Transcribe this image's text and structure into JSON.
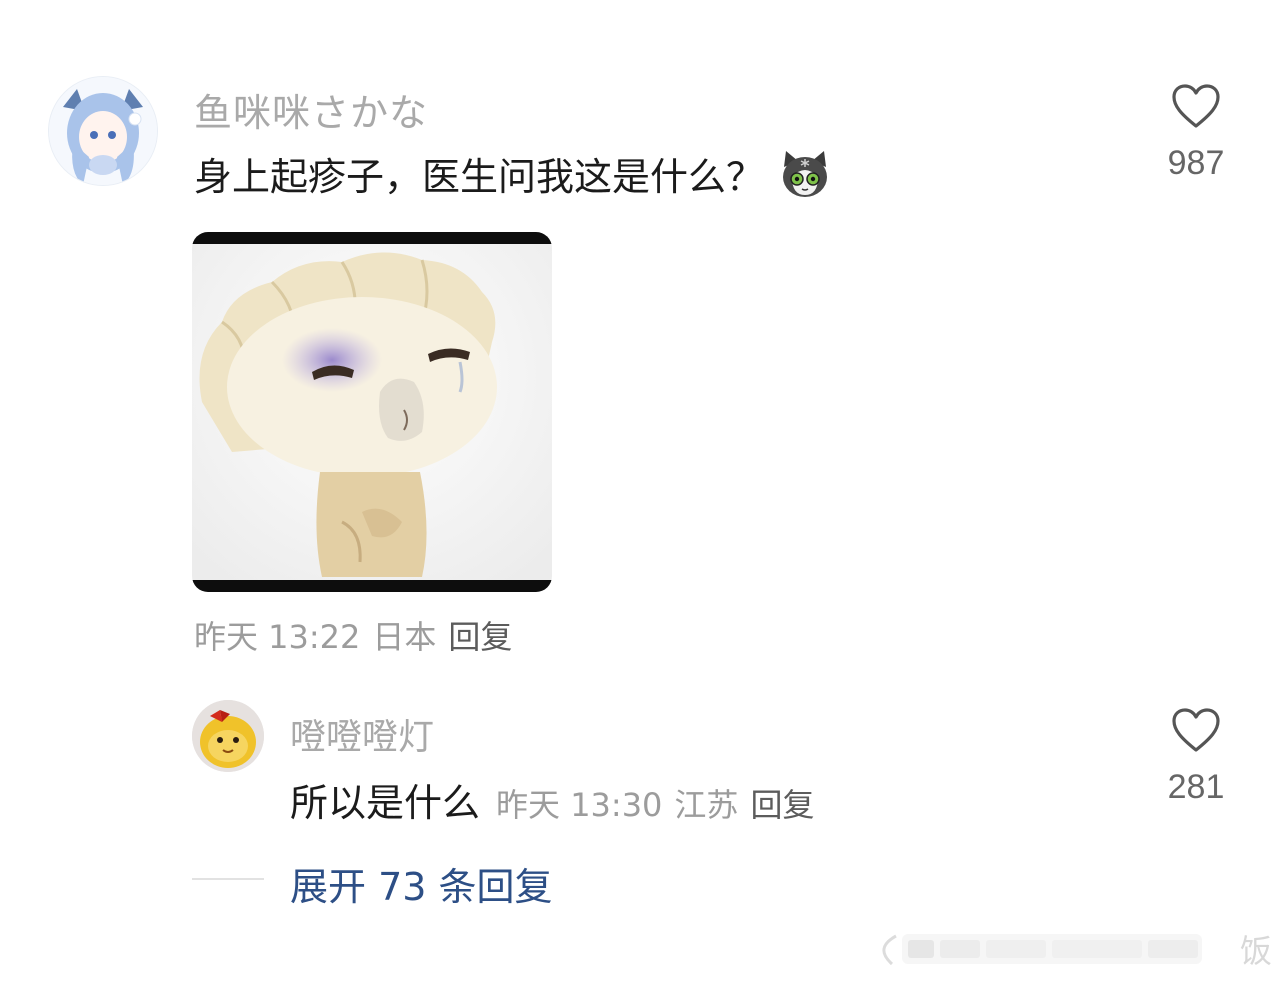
{
  "comment": {
    "username": "鱼咪咪さかな",
    "text": "身上起疹子，医生问我这是什么？",
    "emoji_icon": "gray-cat-emoji",
    "likes": "987",
    "time": "昨天 13:22",
    "location": "日本",
    "reply_label": "回复"
  },
  "reply": {
    "username": "噔噔噔灯",
    "text": "所以是什么",
    "time": "昨天 13:30",
    "location": "江苏",
    "reply_label": "回复",
    "likes": "281"
  },
  "expand": {
    "label": "展开 73 条回复"
  },
  "watermark": {
    "text": "饭"
  },
  "colors": {
    "username": "#a9a9a9",
    "text": "#1b1b1b",
    "meta": "#9c9c9c",
    "link": "#2d4f86"
  }
}
